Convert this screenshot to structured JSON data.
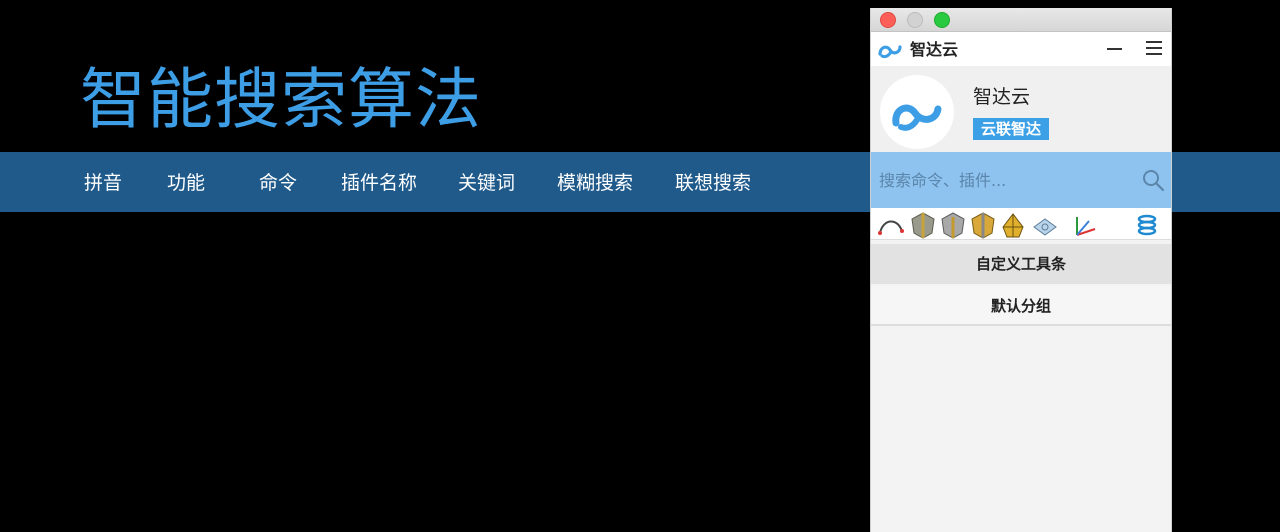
{
  "title": "智能搜索算法",
  "banner": {
    "items": [
      {
        "label": "拼音"
      },
      {
        "label": "功能"
      },
      {
        "label": "命令"
      },
      {
        "label": "插件名称"
      },
      {
        "label": "关键词"
      },
      {
        "label": "模糊搜索"
      },
      {
        "label": "联想搜索"
      }
    ]
  },
  "app": {
    "name": "智达云",
    "profile_name": "智达云",
    "profile_badge": "云联智达",
    "search_placeholder": "搜索命令、插件...",
    "toolbar_icons": [
      "arc-icon",
      "gray-shield-icon",
      "gray-shield-icon",
      "gold-shield-icon",
      "gold-mesh-icon",
      "gear-part-icon",
      "axis-icon",
      "spring-icon"
    ],
    "groups": [
      {
        "label": "自定义工具条"
      },
      {
        "label": "默认分组"
      }
    ],
    "accent_color": "#3ca0e6"
  }
}
